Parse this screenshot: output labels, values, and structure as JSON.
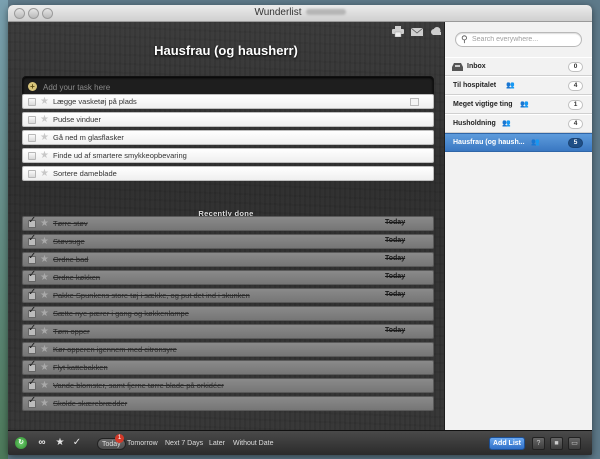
{
  "window": {
    "title": "Wunderlist"
  },
  "toolbar": {
    "icons": [
      "print-icon",
      "mail-icon",
      "cloud-icon"
    ]
  },
  "list_title": "Hausfrau (og hausherr)",
  "add_task": {
    "placeholder": "Add your task here"
  },
  "tasks": [
    {
      "text": "Lægge vasketøj på plads",
      "has_note": true
    },
    {
      "text": "Pudse vinduer",
      "has_note": false
    },
    {
      "text": "Gå ned m glasflasker",
      "has_note": false
    },
    {
      "text": "Finde ud af smartere smykkeopbevaring",
      "has_note": false
    },
    {
      "text": "Sortere dameblade",
      "has_note": false
    }
  ],
  "recently_done": {
    "title": "Recently done",
    "items": [
      {
        "text": "Tørre støv",
        "due": "Today"
      },
      {
        "text": "Støvsuge",
        "due": "Today"
      },
      {
        "text": "Ordne bad",
        "due": "Today"
      },
      {
        "text": "Ordne køkken",
        "due": "Today"
      },
      {
        "text": "Pakke Spunkens store tøj i sække, og put det ind i skunken",
        "due": "Today"
      },
      {
        "text": "Sætte nye pærer i gang og køkkenlampe",
        "due": ""
      },
      {
        "text": "Tøm opper",
        "due": "Today"
      },
      {
        "text": "Kør opperen igennem med citronsyre",
        "due": ""
      },
      {
        "text": "Flyt kattebakken",
        "due": ""
      },
      {
        "text": "Vande blomster, samt fjerne tørre blade på orkidéer",
        "due": ""
      },
      {
        "text": "Skolde skærebrædder",
        "due": ""
      }
    ]
  },
  "sidebar": {
    "search_placeholder": "Search everywhere...",
    "lists": [
      {
        "name": "Inbox",
        "count": "0",
        "shared": false,
        "active": false,
        "icon": "inbox-icon"
      },
      {
        "name": "Til hospitalet",
        "count": "4",
        "shared": true,
        "active": false
      },
      {
        "name": "Meget vigtige ting",
        "count": "1",
        "shared": true,
        "active": false
      },
      {
        "name": "Husholdning",
        "count": "4",
        "shared": true,
        "active": false
      },
      {
        "name": "Hausfrau (og haush...",
        "count": "5",
        "shared": true,
        "active": true
      }
    ]
  },
  "bottombar": {
    "filters": [
      {
        "label": "Today",
        "active": true,
        "badge": "1"
      },
      {
        "label": "Tomorrow",
        "active": false
      },
      {
        "label": "Next 7 Days",
        "active": false
      },
      {
        "label": "Later",
        "active": false
      },
      {
        "label": "Without Date",
        "active": false
      }
    ],
    "add_list_label": "Add List",
    "help_label": "?"
  }
}
